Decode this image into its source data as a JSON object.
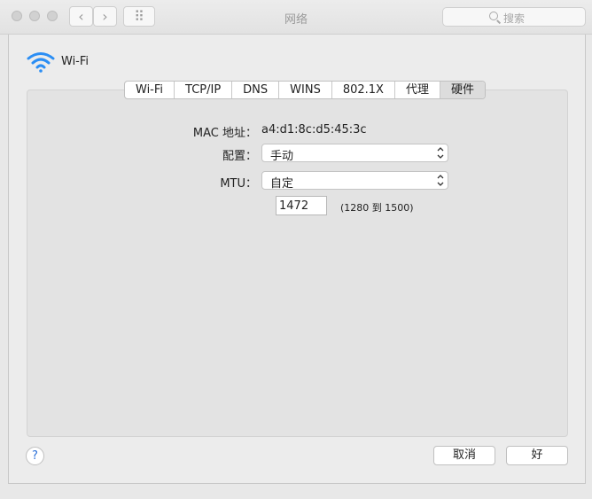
{
  "window": {
    "title": "网络",
    "search_placeholder": "搜索",
    "nav_back": "‹",
    "nav_forward": "›",
    "grid_label": "⠿"
  },
  "sheet": {
    "title": "Wi-Fi",
    "icon": "wifi-icon",
    "accent_color": "#2b8ef4"
  },
  "tabs": [
    {
      "label": "Wi-Fi",
      "active": false
    },
    {
      "label": "TCP/IP",
      "active": false
    },
    {
      "label": "DNS",
      "active": false
    },
    {
      "label": "WINS",
      "active": false
    },
    {
      "label": "802.1X",
      "active": false
    },
    {
      "label": "代理",
      "active": false
    },
    {
      "label": "硬件",
      "active": true
    }
  ],
  "hardware": {
    "mac_label": "MAC 地址：",
    "mac_value": "a4:d1:8c:d5:45:3c",
    "config_label": "配置：",
    "config_value": "手动",
    "mtu_label": "MTU：",
    "mtu_value": "自定",
    "mtu_input": "1472",
    "mtu_range": "(1280 到 1500)"
  },
  "footer": {
    "help": "?",
    "cancel": "取消",
    "ok": "好"
  }
}
